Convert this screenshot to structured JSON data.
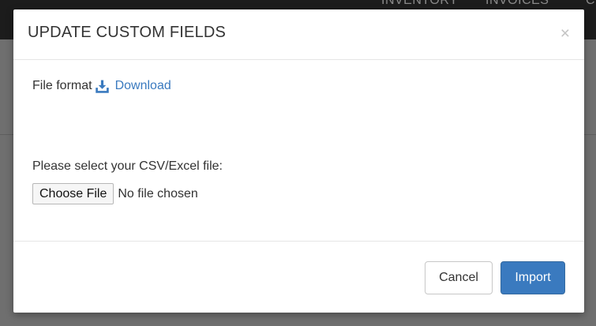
{
  "background": {
    "nav": [
      "INVENTORY",
      "INVOICES",
      "CU"
    ]
  },
  "modal": {
    "title": "UPDATE CUSTOM FIELDS",
    "close_symbol": "×",
    "file_format_label": "File format",
    "download_icon": "download-icon",
    "download_link": "Download",
    "select_label": "Please select your CSV/Excel file:",
    "choose_file_button": "Choose File",
    "file_status": "No file chosen",
    "cancel_button": "Cancel",
    "import_button": "Import"
  },
  "colors": {
    "primary": "#3a7abf",
    "text": "#333333",
    "backdrop": "#6f6f6f"
  }
}
